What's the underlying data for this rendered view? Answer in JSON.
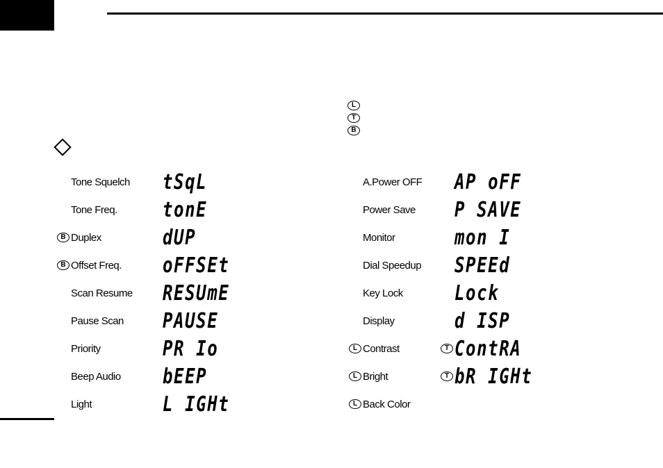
{
  "legend": [
    {
      "mark": "L"
    },
    {
      "mark": "T"
    },
    {
      "mark": "B"
    }
  ],
  "left": [
    {
      "mark": "",
      "label": "Tone Squelch",
      "pre": "",
      "seg": "tSqL"
    },
    {
      "mark": "",
      "label": "Tone Freq.",
      "pre": "",
      "seg": "tonE"
    },
    {
      "mark": "B",
      "label": "Duplex",
      "pre": "",
      "seg": "dUP"
    },
    {
      "mark": "B",
      "label": "Offset Freq.",
      "pre": "",
      "seg": "oFFSEt"
    },
    {
      "mark": "",
      "label": "Scan Resume",
      "pre": "",
      "seg": "RESUmE"
    },
    {
      "mark": "",
      "label": "Pause Scan",
      "pre": "",
      "seg": "PAUSE"
    },
    {
      "mark": "",
      "label": "Priority",
      "pre": "",
      "seg": "PR Io"
    },
    {
      "mark": "",
      "label": "Beep Audio",
      "pre": "",
      "seg": "bEEP"
    },
    {
      "mark": "",
      "label": "Light",
      "pre": "",
      "seg": "L IGHt"
    }
  ],
  "right": [
    {
      "mark": "",
      "label": "A.Power OFF",
      "pre": "",
      "seg": "AP oFF"
    },
    {
      "mark": "",
      "label": "Power Save",
      "pre": "",
      "seg": "P SAVE"
    },
    {
      "mark": "",
      "label": "Monitor",
      "pre": "",
      "seg": "mon I"
    },
    {
      "mark": "",
      "label": "Dial Speedup",
      "pre": "",
      "seg": "SPEEd"
    },
    {
      "mark": "",
      "label": "Key Lock",
      "pre": "",
      "seg": "Lock"
    },
    {
      "mark": "",
      "label": "Display",
      "pre": "",
      "seg": "d ISP"
    },
    {
      "mark": "L",
      "label": "Contrast",
      "pre": "T",
      "seg": "ContRA"
    },
    {
      "mark": "L",
      "label": "Bright",
      "pre": "T",
      "seg": "bR IGHt"
    },
    {
      "mark": "L",
      "label": "Back Color",
      "pre": "",
      "seg": ""
    }
  ]
}
